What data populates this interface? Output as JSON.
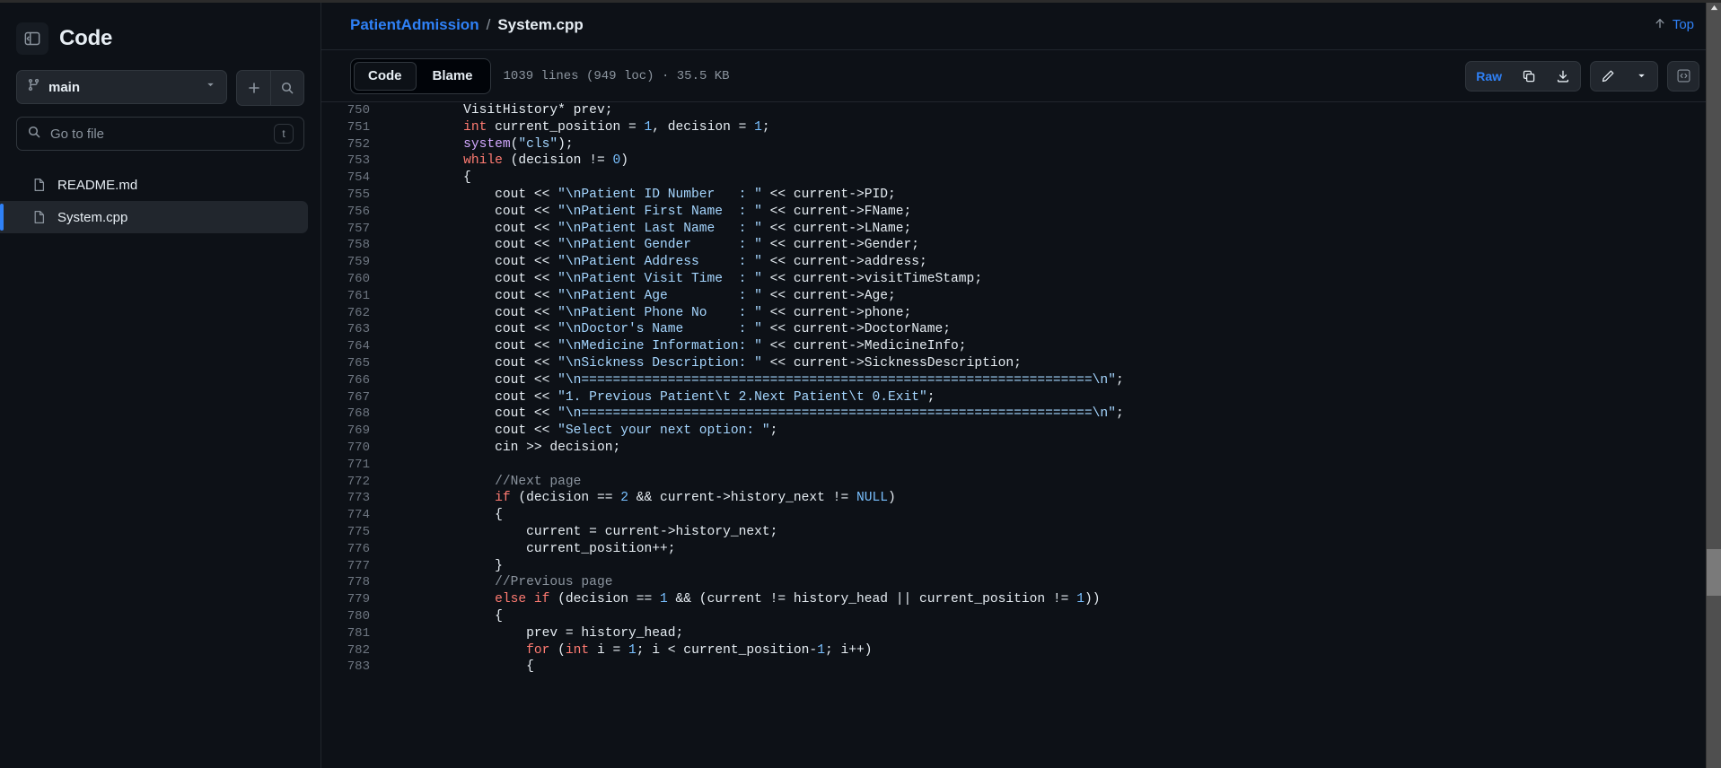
{
  "sidebar": {
    "toggle_icon": "side-panel-collapse-icon",
    "title": "Code",
    "branch": {
      "icon": "git-branch-icon",
      "name": "main",
      "chevron_icon": "chevron-down-icon"
    },
    "actions": [
      {
        "icon": "plus-icon",
        "name": "add-file-button"
      },
      {
        "icon": "search-icon",
        "name": "search-repo-button"
      }
    ],
    "file_search": {
      "icon": "search-icon",
      "placeholder": "Go to file",
      "value": "",
      "shortcut": "t"
    },
    "files": [
      {
        "icon": "file-icon",
        "label": "README.md",
        "selected": false
      },
      {
        "icon": "file-icon",
        "label": "System.cpp",
        "selected": true
      }
    ]
  },
  "header": {
    "breadcrumb": {
      "repo": "PatientAdmission",
      "separator": "/",
      "file": "System.cpp"
    },
    "top_link": {
      "icon": "arrow-up-icon",
      "label": "Top"
    }
  },
  "toolbar": {
    "tabs": [
      {
        "label": "Code",
        "active": true
      },
      {
        "label": "Blame",
        "active": false
      }
    ],
    "file_meta": "1039 lines (949 loc) · 35.5 KB",
    "actions": {
      "raw_label": "Raw",
      "copy_icon": "copy-icon",
      "download_icon": "download-icon",
      "edit_icon": "pencil-icon",
      "edit_dropdown_icon": "chevron-down-icon",
      "symbols_icon": "code-brackets-icon"
    }
  },
  "colors": {
    "accent": "#2f81f7",
    "background": "#0d1117",
    "panel": "#21262d",
    "border": "#30363d",
    "text": "#e6edf3",
    "muted": "#8b949e",
    "keyword": "#ff7b72",
    "string": "#a5d6ff",
    "number": "#79c0ff",
    "comment": "#8b949e"
  },
  "code": {
    "first_line": 750,
    "lines": [
      {
        "n": 750,
        "tokens": [
          {
            "t": "        ",
            "c": "pl"
          },
          {
            "t": "VisitHistory* prev;",
            "c": "pl"
          }
        ]
      },
      {
        "n": 751,
        "tokens": [
          {
            "t": "        ",
            "c": "pl"
          },
          {
            "t": "int",
            "c": "kw"
          },
          {
            "t": " current_position = ",
            "c": "pl"
          },
          {
            "t": "1",
            "c": "num"
          },
          {
            "t": ", decision = ",
            "c": "pl"
          },
          {
            "t": "1",
            "c": "num"
          },
          {
            "t": ";",
            "c": "pl"
          }
        ]
      },
      {
        "n": 752,
        "tokens": [
          {
            "t": "        ",
            "c": "pl"
          },
          {
            "t": "system",
            "c": "fn"
          },
          {
            "t": "(",
            "c": "pl"
          },
          {
            "t": "\"cls\"",
            "c": "str"
          },
          {
            "t": ");",
            "c": "pl"
          }
        ]
      },
      {
        "n": 753,
        "tokens": [
          {
            "t": "        ",
            "c": "pl"
          },
          {
            "t": "while",
            "c": "kw"
          },
          {
            "t": " (decision != ",
            "c": "pl"
          },
          {
            "t": "0",
            "c": "num"
          },
          {
            "t": ")",
            "c": "pl"
          }
        ]
      },
      {
        "n": 754,
        "tokens": [
          {
            "t": "        {",
            "c": "pl"
          }
        ]
      },
      {
        "n": 755,
        "tokens": [
          {
            "t": "            cout << ",
            "c": "pl"
          },
          {
            "t": "\"\\nPatient ID Number   : \"",
            "c": "str"
          },
          {
            "t": " << current->PID;",
            "c": "pl"
          }
        ]
      },
      {
        "n": 756,
        "tokens": [
          {
            "t": "            cout << ",
            "c": "pl"
          },
          {
            "t": "\"\\nPatient First Name  : \"",
            "c": "str"
          },
          {
            "t": " << current->FName;",
            "c": "pl"
          }
        ]
      },
      {
        "n": 757,
        "tokens": [
          {
            "t": "            cout << ",
            "c": "pl"
          },
          {
            "t": "\"\\nPatient Last Name   : \"",
            "c": "str"
          },
          {
            "t": " << current->LName;",
            "c": "pl"
          }
        ]
      },
      {
        "n": 758,
        "tokens": [
          {
            "t": "            cout << ",
            "c": "pl"
          },
          {
            "t": "\"\\nPatient Gender      : \"",
            "c": "str"
          },
          {
            "t": " << current->Gender;",
            "c": "pl"
          }
        ]
      },
      {
        "n": 759,
        "tokens": [
          {
            "t": "            cout << ",
            "c": "pl"
          },
          {
            "t": "\"\\nPatient Address     : \"",
            "c": "str"
          },
          {
            "t": " << current->address;",
            "c": "pl"
          }
        ]
      },
      {
        "n": 760,
        "tokens": [
          {
            "t": "            cout << ",
            "c": "pl"
          },
          {
            "t": "\"\\nPatient Visit Time  : \"",
            "c": "str"
          },
          {
            "t": " << current->visitTimeStamp;",
            "c": "pl"
          }
        ]
      },
      {
        "n": 761,
        "tokens": [
          {
            "t": "            cout << ",
            "c": "pl"
          },
          {
            "t": "\"\\nPatient Age         : \"",
            "c": "str"
          },
          {
            "t": " << current->Age;",
            "c": "pl"
          }
        ]
      },
      {
        "n": 762,
        "tokens": [
          {
            "t": "            cout << ",
            "c": "pl"
          },
          {
            "t": "\"\\nPatient Phone No    : \"",
            "c": "str"
          },
          {
            "t": " << current->phone;",
            "c": "pl"
          }
        ]
      },
      {
        "n": 763,
        "tokens": [
          {
            "t": "            cout << ",
            "c": "pl"
          },
          {
            "t": "\"\\nDoctor's Name       : \"",
            "c": "str"
          },
          {
            "t": " << current->DoctorName;",
            "c": "pl"
          }
        ]
      },
      {
        "n": 764,
        "tokens": [
          {
            "t": "            cout << ",
            "c": "pl"
          },
          {
            "t": "\"\\nMedicine Information: \"",
            "c": "str"
          },
          {
            "t": " << current->MedicineInfo;",
            "c": "pl"
          }
        ]
      },
      {
        "n": 765,
        "tokens": [
          {
            "t": "            cout << ",
            "c": "pl"
          },
          {
            "t": "\"\\nSickness Description: \"",
            "c": "str"
          },
          {
            "t": " << current->SicknessDescription;",
            "c": "pl"
          }
        ]
      },
      {
        "n": 766,
        "tokens": [
          {
            "t": "            cout << ",
            "c": "pl"
          },
          {
            "t": "\"\\n=================================================================\\n\"",
            "c": "str"
          },
          {
            "t": ";",
            "c": "pl"
          }
        ]
      },
      {
        "n": 767,
        "tokens": [
          {
            "t": "            cout << ",
            "c": "pl"
          },
          {
            "t": "\"1. Previous Patient\\t 2.Next Patient\\t 0.Exit\"",
            "c": "str"
          },
          {
            "t": ";",
            "c": "pl"
          }
        ]
      },
      {
        "n": 768,
        "tokens": [
          {
            "t": "            cout << ",
            "c": "pl"
          },
          {
            "t": "\"\\n=================================================================\\n\"",
            "c": "str"
          },
          {
            "t": ";",
            "c": "pl"
          }
        ]
      },
      {
        "n": 769,
        "tokens": [
          {
            "t": "            cout << ",
            "c": "pl"
          },
          {
            "t": "\"Select your next option: \"",
            "c": "str"
          },
          {
            "t": ";",
            "c": "pl"
          }
        ]
      },
      {
        "n": 770,
        "tokens": [
          {
            "t": "            cin >> decision;",
            "c": "pl"
          }
        ]
      },
      {
        "n": 771,
        "tokens": [
          {
            "t": "",
            "c": "pl"
          }
        ]
      },
      {
        "n": 772,
        "tokens": [
          {
            "t": "            ",
            "c": "pl"
          },
          {
            "t": "//Next page",
            "c": "cmt"
          }
        ]
      },
      {
        "n": 773,
        "tokens": [
          {
            "t": "            ",
            "c": "pl"
          },
          {
            "t": "if",
            "c": "kw"
          },
          {
            "t": " (decision == ",
            "c": "pl"
          },
          {
            "t": "2",
            "c": "num"
          },
          {
            "t": " && current->history_next != ",
            "c": "pl"
          },
          {
            "t": "NULL",
            "c": "cst"
          },
          {
            "t": ")",
            "c": "pl"
          }
        ]
      },
      {
        "n": 774,
        "tokens": [
          {
            "t": "            {",
            "c": "pl"
          }
        ]
      },
      {
        "n": 775,
        "tokens": [
          {
            "t": "                current = current->history_next;",
            "c": "pl"
          }
        ]
      },
      {
        "n": 776,
        "tokens": [
          {
            "t": "                current_position++;",
            "c": "pl"
          }
        ]
      },
      {
        "n": 777,
        "tokens": [
          {
            "t": "            }",
            "c": "pl"
          }
        ]
      },
      {
        "n": 778,
        "tokens": [
          {
            "t": "            ",
            "c": "pl"
          },
          {
            "t": "//Previous page",
            "c": "cmt"
          }
        ]
      },
      {
        "n": 779,
        "tokens": [
          {
            "t": "            ",
            "c": "pl"
          },
          {
            "t": "else",
            "c": "kw"
          },
          {
            "t": " ",
            "c": "pl"
          },
          {
            "t": "if",
            "c": "kw"
          },
          {
            "t": " (decision == ",
            "c": "pl"
          },
          {
            "t": "1",
            "c": "num"
          },
          {
            "t": " && (current != history_head || current_position != ",
            "c": "pl"
          },
          {
            "t": "1",
            "c": "num"
          },
          {
            "t": "))",
            "c": "pl"
          }
        ]
      },
      {
        "n": 780,
        "tokens": [
          {
            "t": "            {",
            "c": "pl"
          }
        ]
      },
      {
        "n": 781,
        "tokens": [
          {
            "t": "                prev = history_head;",
            "c": "pl"
          }
        ]
      },
      {
        "n": 782,
        "tokens": [
          {
            "t": "                ",
            "c": "pl"
          },
          {
            "t": "for",
            "c": "kw"
          },
          {
            "t": " (",
            "c": "pl"
          },
          {
            "t": "int",
            "c": "kw"
          },
          {
            "t": " i = ",
            "c": "pl"
          },
          {
            "t": "1",
            "c": "num"
          },
          {
            "t": "; i < current_position-",
            "c": "pl"
          },
          {
            "t": "1",
            "c": "num"
          },
          {
            "t": "; i++)",
            "c": "pl"
          }
        ]
      },
      {
        "n": 783,
        "tokens": [
          {
            "t": "                {",
            "c": "pl"
          }
        ]
      }
    ]
  }
}
